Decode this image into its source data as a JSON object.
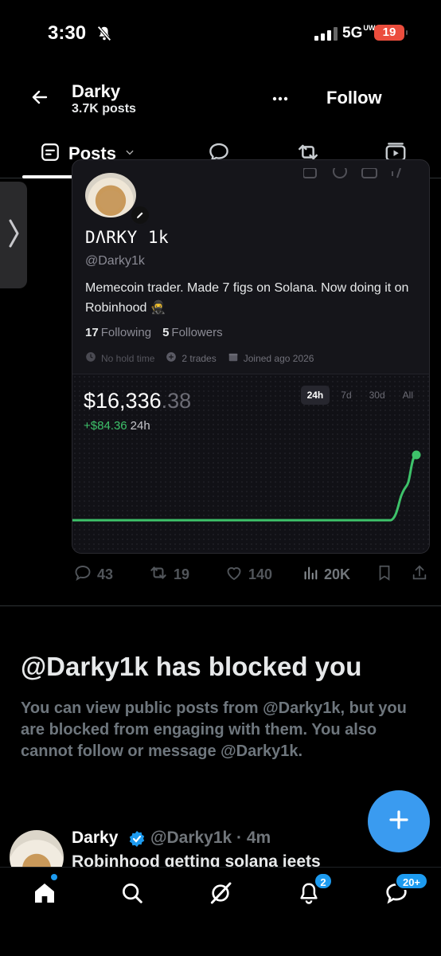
{
  "status_bar": {
    "time": "3:30",
    "network": "5G",
    "network_sub": "UW",
    "battery": "19"
  },
  "header": {
    "name": "Darky",
    "posts": "3.7K posts",
    "follow_label": "Follow"
  },
  "tabs": {
    "posts_label": "Posts"
  },
  "card": {
    "display_name": "DΛRKY 1k",
    "handle": "@Darky1k",
    "bio": "Memecoin trader. Made 7 figs on Solana. Now doing it on Robinhood 🥷",
    "following_count": "17",
    "following_label": "Following",
    "followers_count": "5",
    "followers_label": "Followers",
    "meta": {
      "hold": "No hold time",
      "trades": "2 trades",
      "joined": "Joined ago 2026"
    },
    "balance_main": "$16,336",
    "balance_cents": ".38",
    "change": "+$84.36",
    "change_period": "24h",
    "ranges": [
      "24h",
      "7d",
      "30d",
      "All"
    ],
    "active_range": "24h",
    "line_color": "#3ec26a"
  },
  "actions": {
    "replies": "43",
    "reposts": "19",
    "likes": "140",
    "views": "20K"
  },
  "blocked": {
    "title": "@Darky1k has blocked you",
    "body": "You can view public posts from @Darky1k, but you are blocked from engaging with them. You also cannot follow or message @Darky1k."
  },
  "next_post": {
    "name": "Darky",
    "handle": "@Darky1k · 4m",
    "text": "Robinhood getting solana jeets"
  },
  "bottom_nav": {
    "notifications_badge": "2",
    "messages_badge": "20+"
  },
  "colors": {
    "accent": "#1d9bf0",
    "fab": "#3a9bf0",
    "battery": "#eb4d3d"
  },
  "icons": [
    "back-arrow-icon",
    "more-icon",
    "posts-tab-icon",
    "reply-tab-icon",
    "repost-tab-icon",
    "video-tab-icon",
    "chevron-right-icon",
    "edit-icon",
    "clock-icon",
    "trades-icon",
    "calendar-icon",
    "reply-icon",
    "repost-icon",
    "like-icon",
    "views-icon",
    "bookmark-icon",
    "share-icon",
    "plus-icon",
    "verified-icon",
    "home-icon",
    "search-icon",
    "grok-icon",
    "bell-icon",
    "mail-icon"
  ]
}
